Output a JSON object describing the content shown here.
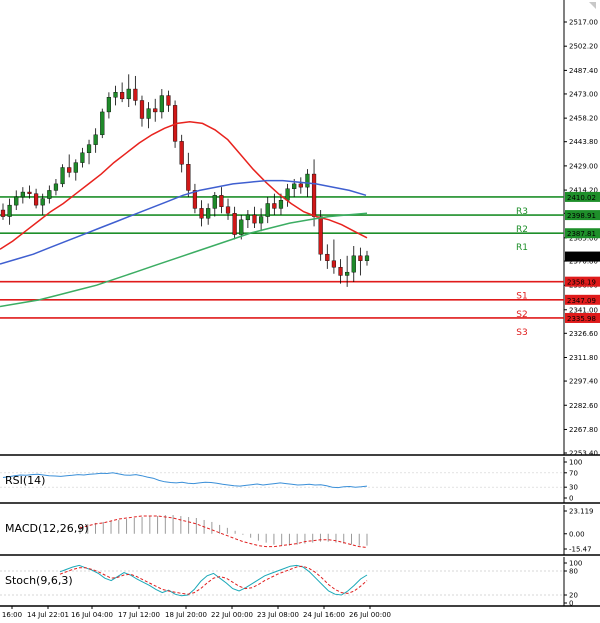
{
  "chart_data": {
    "type": "candlestick",
    "symbol_panel": {
      "price_ticks": [
        "2517.00",
        "2502.20",
        "2487.40",
        "2473.00",
        "2458.20",
        "2443.80",
        "2429.00",
        "2414.20",
        "2400.00",
        "2385.00",
        "2370.80",
        "2356.00",
        "2341.00",
        "2326.60",
        "2311.80",
        "2297.40",
        "2282.60",
        "2267.80",
        "2253.40"
      ],
      "ylim": [
        2253.4,
        2522.5
      ],
      "candles": [
        {
          "o": 2402,
          "h": 2406,
          "l": 2396,
          "c": 2398
        },
        {
          "o": 2398,
          "h": 2409,
          "l": 2393,
          "c": 2405
        },
        {
          "o": 2405,
          "h": 2414,
          "l": 2402,
          "c": 2410
        },
        {
          "o": 2410,
          "h": 2416,
          "l": 2406,
          "c": 2413
        },
        {
          "o": 2413,
          "h": 2417,
          "l": 2409,
          "c": 2412
        },
        {
          "o": 2412,
          "h": 2415,
          "l": 2403,
          "c": 2405
        },
        {
          "o": 2405,
          "h": 2412,
          "l": 2399,
          "c": 2409
        },
        {
          "o": 2409,
          "h": 2417,
          "l": 2406,
          "c": 2414
        },
        {
          "o": 2414,
          "h": 2421,
          "l": 2411,
          "c": 2418
        },
        {
          "o": 2418,
          "h": 2430,
          "l": 2416,
          "c": 2428
        },
        {
          "o": 2428,
          "h": 2436,
          "l": 2422,
          "c": 2425
        },
        {
          "o": 2425,
          "h": 2433,
          "l": 2420,
          "c": 2431
        },
        {
          "o": 2431,
          "h": 2440,
          "l": 2428,
          "c": 2437
        },
        {
          "o": 2437,
          "h": 2445,
          "l": 2430,
          "c": 2442
        },
        {
          "o": 2442,
          "h": 2452,
          "l": 2437,
          "c": 2448
        },
        {
          "o": 2448,
          "h": 2464,
          "l": 2446,
          "c": 2462
        },
        {
          "o": 2462,
          "h": 2474,
          "l": 2458,
          "c": 2471
        },
        {
          "o": 2471,
          "h": 2478,
          "l": 2466,
          "c": 2474
        },
        {
          "o": 2474,
          "h": 2480,
          "l": 2468,
          "c": 2470
        },
        {
          "o": 2470,
          "h": 2485,
          "l": 2465,
          "c": 2476
        },
        {
          "o": 2476,
          "h": 2484,
          "l": 2466,
          "c": 2469
        },
        {
          "o": 2469,
          "h": 2472,
          "l": 2453,
          "c": 2458
        },
        {
          "o": 2458,
          "h": 2468,
          "l": 2452,
          "c": 2464
        },
        {
          "o": 2464,
          "h": 2470,
          "l": 2456,
          "c": 2462
        },
        {
          "o": 2462,
          "h": 2476,
          "l": 2458,
          "c": 2472
        },
        {
          "o": 2472,
          "h": 2475,
          "l": 2462,
          "c": 2466
        },
        {
          "o": 2466,
          "h": 2469,
          "l": 2440,
          "c": 2444
        },
        {
          "o": 2444,
          "h": 2448,
          "l": 2425,
          "c": 2430
        },
        {
          "o": 2430,
          "h": 2437,
          "l": 2410,
          "c": 2414
        },
        {
          "o": 2414,
          "h": 2418,
          "l": 2400,
          "c": 2403
        },
        {
          "o": 2403,
          "h": 2408,
          "l": 2392,
          "c": 2397
        },
        {
          "o": 2397,
          "h": 2406,
          "l": 2393,
          "c": 2403
        },
        {
          "o": 2403,
          "h": 2413,
          "l": 2398,
          "c": 2411
        },
        {
          "o": 2411,
          "h": 2416,
          "l": 2400,
          "c": 2404
        },
        {
          "o": 2404,
          "h": 2409,
          "l": 2396,
          "c": 2400
        },
        {
          "o": 2400,
          "h": 2404,
          "l": 2384,
          "c": 2387
        },
        {
          "o": 2387,
          "h": 2399,
          "l": 2384,
          "c": 2396
        },
        {
          "o": 2396,
          "h": 2402,
          "l": 2391,
          "c": 2399
        },
        {
          "o": 2399,
          "h": 2404,
          "l": 2391,
          "c": 2394
        },
        {
          "o": 2394,
          "h": 2403,
          "l": 2389,
          "c": 2398
        },
        {
          "o": 2398,
          "h": 2410,
          "l": 2394,
          "c": 2406
        },
        {
          "o": 2406,
          "h": 2412,
          "l": 2399,
          "c": 2403
        },
        {
          "o": 2403,
          "h": 2412,
          "l": 2399,
          "c": 2408
        },
        {
          "o": 2408,
          "h": 2418,
          "l": 2404,
          "c": 2415
        },
        {
          "o": 2415,
          "h": 2421,
          "l": 2410,
          "c": 2418
        },
        {
          "o": 2418,
          "h": 2422,
          "l": 2412,
          "c": 2416
        },
        {
          "o": 2416,
          "h": 2427,
          "l": 2410,
          "c": 2424
        },
        {
          "o": 2424,
          "h": 2433,
          "l": 2392,
          "c": 2398
        },
        {
          "o": 2398,
          "h": 2402,
          "l": 2371,
          "c": 2375
        },
        {
          "o": 2375,
          "h": 2381,
          "l": 2366,
          "c": 2371
        },
        {
          "o": 2371,
          "h": 2384,
          "l": 2363,
          "c": 2367
        },
        {
          "o": 2367,
          "h": 2372,
          "l": 2357,
          "c": 2362
        },
        {
          "o": 2362,
          "h": 2374,
          "l": 2355,
          "c": 2364
        },
        {
          "o": 2364,
          "h": 2380,
          "l": 2358,
          "c": 2374
        },
        {
          "o": 2374,
          "h": 2379,
          "l": 2362,
          "c": 2371
        },
        {
          "o": 2371,
          "h": 2377,
          "l": 2368,
          "c": 2374
        }
      ],
      "series": [
        {
          "name": "",
          "color": "#e8231e",
          "values": [
            2378,
            2383,
            2389,
            2395,
            2401,
            2406,
            2412,
            2418,
            2424,
            2431,
            2437,
            2443,
            2448,
            2452,
            2455,
            2456,
            2455,
            2451,
            2445,
            2436,
            2427,
            2419,
            2412,
            2406,
            2401,
            2398,
            2396,
            2393,
            2389,
            2385
          ]
        },
        {
          "name": "",
          "color": "#3f5fd0",
          "values": [
            2369,
            2372,
            2375,
            2379,
            2383,
            2387,
            2391,
            2395,
            2399,
            2403,
            2407,
            2411,
            2414,
            2416,
            2418,
            2419,
            2420,
            2420,
            2419,
            2418,
            2416,
            2414,
            2411
          ]
        },
        {
          "name": "",
          "color": "#3cad63",
          "values": [
            2343,
            2345,
            2347,
            2350,
            2353,
            2356,
            2360,
            2364,
            2368,
            2372,
            2376,
            2380,
            2384,
            2388,
            2391,
            2394,
            2396,
            2398,
            2399,
            2400
          ]
        }
      ],
      "levels": [
        {
          "name": "R3",
          "value": "2410.02",
          "color": "#1e8f2a"
        },
        {
          "name": "R2",
          "value": "2398.91",
          "color": "#1e8f2a"
        },
        {
          "name": "R1",
          "value": "2387.81",
          "color": "#1e8f2a"
        },
        {
          "name": "S1",
          "value": "2358.19",
          "color": "#e01b1b"
        },
        {
          "name": "S2",
          "value": "2347.09",
          "color": "#e01b1b"
        },
        {
          "name": "S3",
          "value": "2335.98",
          "color": "#e01b1b"
        }
      ],
      "current_price": "2373.54"
    },
    "rsi_panel": {
      "label": "RSI(14)",
      "ticks": [
        "100",
        "70",
        "30",
        "0"
      ],
      "values": [
        57,
        59,
        62,
        64,
        63,
        65,
        66,
        64,
        62,
        61,
        60,
        62,
        63,
        65,
        64,
        66,
        67,
        69,
        68,
        70,
        67,
        64,
        63,
        65,
        62,
        58,
        55,
        49,
        45,
        43,
        42,
        44,
        41,
        40,
        42,
        44,
        43,
        41,
        38,
        36,
        34,
        33,
        35,
        37,
        39,
        36,
        38,
        40,
        42,
        40,
        38,
        36,
        37,
        38,
        36,
        37,
        34,
        30,
        29,
        31,
        32,
        30,
        31,
        33
      ]
    },
    "macd_panel": {
      "label": "MACD(12,26,9)",
      "ticks": [
        "23.119",
        "0.00",
        "-15.47"
      ],
      "hist": [
        8,
        10,
        11,
        12,
        13,
        14,
        15,
        16,
        17,
        18,
        18,
        19,
        19,
        18,
        17,
        16,
        14,
        12,
        9,
        6,
        3,
        -1,
        -4,
        -7,
        -9,
        -11,
        -12,
        -12,
        -11,
        -10,
        -9,
        -8,
        -8,
        -9,
        -10,
        -11,
        -12,
        -12
      ],
      "signal": [
        6,
        8,
        10,
        11,
        13,
        15,
        16,
        17,
        18,
        18,
        18,
        17,
        16,
        14,
        12,
        10,
        7,
        4,
        1,
        -2,
        -5,
        -8,
        -10,
        -12,
        -13,
        -13,
        -12,
        -11,
        -10,
        -8,
        -7,
        -6,
        -6,
        -7,
        -9,
        -11,
        -13,
        -14
      ]
    },
    "stoch_panel": {
      "label": "Stoch(9,6,3)",
      "ticks": [
        "100",
        "80",
        "20",
        "0"
      ],
      "k": [
        78,
        84,
        90,
        94,
        88,
        82,
        74,
        62,
        56,
        66,
        76,
        70,
        60,
        52,
        44,
        34,
        26,
        32,
        22,
        18,
        20,
        34,
        54,
        68,
        74,
        62,
        50,
        36,
        30,
        38,
        48,
        58,
        68,
        74,
        80,
        86,
        92,
        94,
        90,
        78,
        62,
        46,
        30,
        22,
        20,
        30,
        44,
        60,
        70
      ],
      "d": [
        72,
        78,
        84,
        88,
        88,
        84,
        78,
        70,
        62,
        64,
        70,
        72,
        66,
        58,
        50,
        42,
        34,
        30,
        27,
        24,
        22,
        26,
        36,
        50,
        62,
        66,
        62,
        52,
        42,
        36,
        38,
        46,
        56,
        64,
        72,
        78,
        84,
        90,
        92,
        86,
        76,
        62,
        46,
        34,
        26,
        24,
        30,
        42,
        56
      ]
    },
    "x_ticks": [
      "16:00",
      "14 Jul 22:01",
      "16 Jul 04:00",
      "17 Jul 12:00",
      "18 Jul 20:00",
      "22 Jul 00:00",
      "23 Jul 08:00",
      "24 Jul 16:00",
      "26 Jul 00:00"
    ]
  }
}
